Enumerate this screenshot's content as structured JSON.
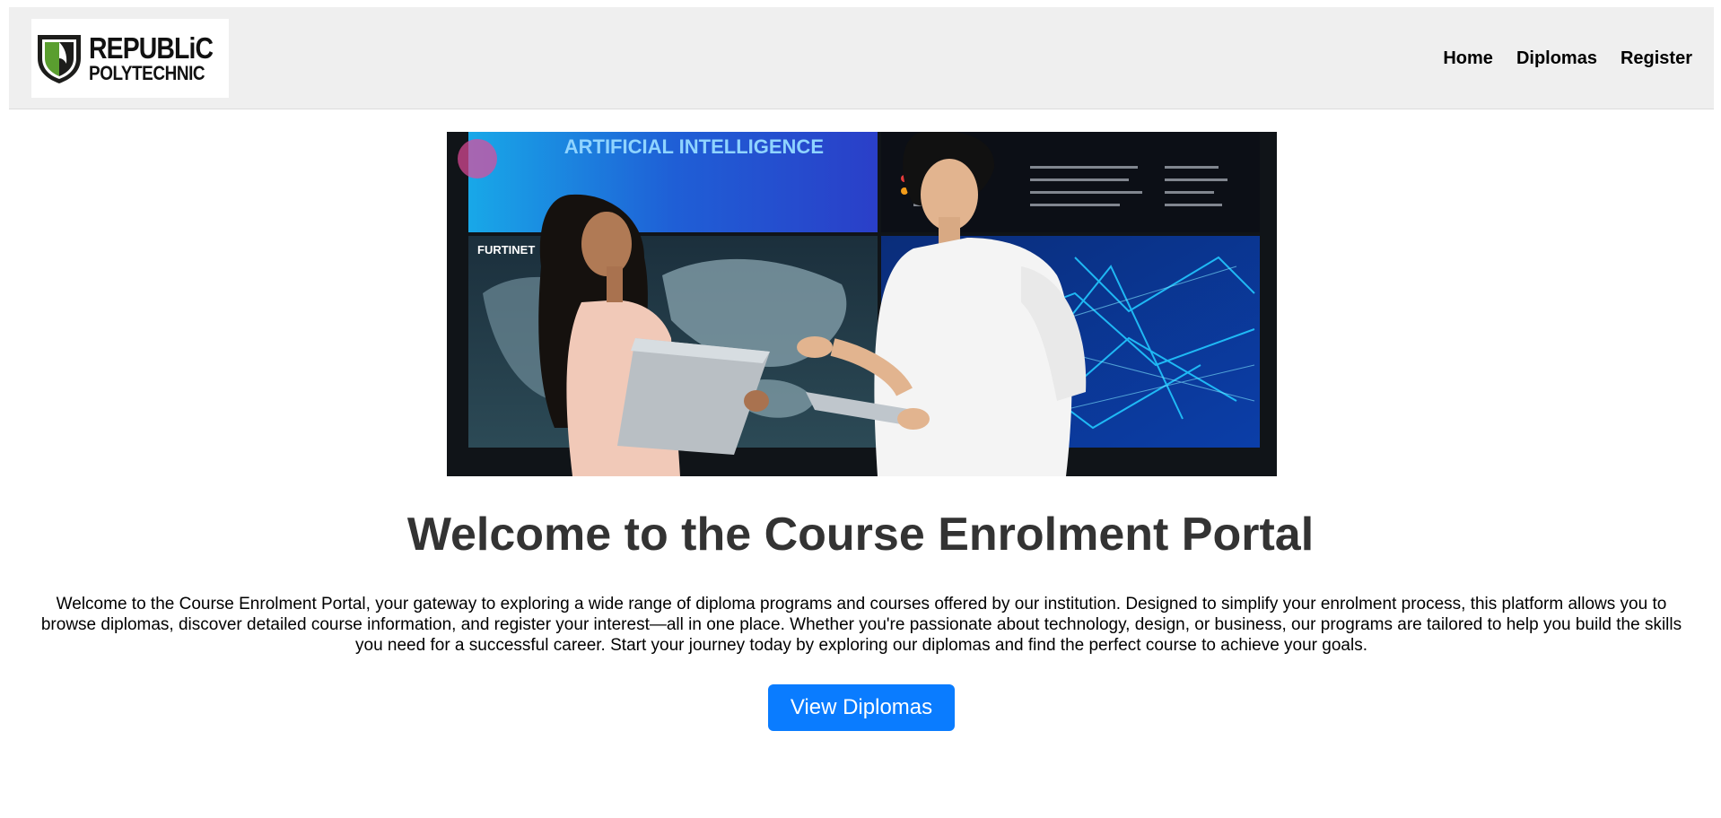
{
  "header": {
    "logo": {
      "line1": "REPUBLiC",
      "line2": "POLYTECHNIC",
      "shield_colors": [
        "#5a9e2f",
        "#1d1d1b"
      ]
    },
    "nav": [
      {
        "label": "Home"
      },
      {
        "label": "Diplomas"
      },
      {
        "label": "Register"
      }
    ]
  },
  "hero": {
    "screen_text": "ARTIFICIAL INTELLIGENCE",
    "screen_brand": "FURTINET",
    "colors": {
      "screen_blue": "#1f5fd6",
      "cyan": "#22c7ff",
      "dark": "#0b1a33"
    }
  },
  "main": {
    "title": "Welcome to the Course Enrolment Portal",
    "intro": "Welcome to the Course Enrolment Portal, your gateway to exploring a wide range of diploma programs and courses offered by our institution. Designed to simplify your enrolment process, this platform allows you to browse diplomas, discover detailed course information, and register your interest—all in one place. Whether you're passionate about technology, design, or business, our programs are tailored to help you build the skills you need for a successful career. Start your journey today by exploring our diplomas and find the perfect course to achieve your goals.",
    "cta_label": "View Diplomas",
    "accent": "#0a7cff"
  }
}
